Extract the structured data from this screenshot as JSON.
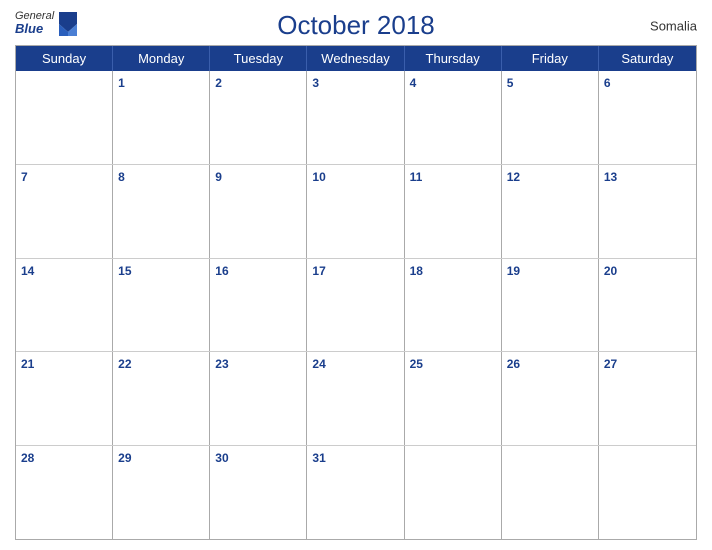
{
  "header": {
    "logo_general": "General",
    "logo_blue": "Blue",
    "title": "October 2018",
    "country": "Somalia"
  },
  "days_of_week": [
    "Sunday",
    "Monday",
    "Tuesday",
    "Wednesday",
    "Thursday",
    "Friday",
    "Saturday"
  ],
  "weeks": [
    [
      null,
      1,
      2,
      3,
      4,
      5,
      6
    ],
    [
      7,
      8,
      9,
      10,
      11,
      12,
      13
    ],
    [
      14,
      15,
      16,
      17,
      18,
      19,
      20
    ],
    [
      21,
      22,
      23,
      24,
      25,
      26,
      27
    ],
    [
      28,
      29,
      30,
      31,
      null,
      null,
      null
    ]
  ],
  "colors": {
    "header_bg": "#1a3e8c",
    "header_text": "#ffffff",
    "title_color": "#1a3e8c",
    "day_num_color": "#1a3e8c"
  }
}
